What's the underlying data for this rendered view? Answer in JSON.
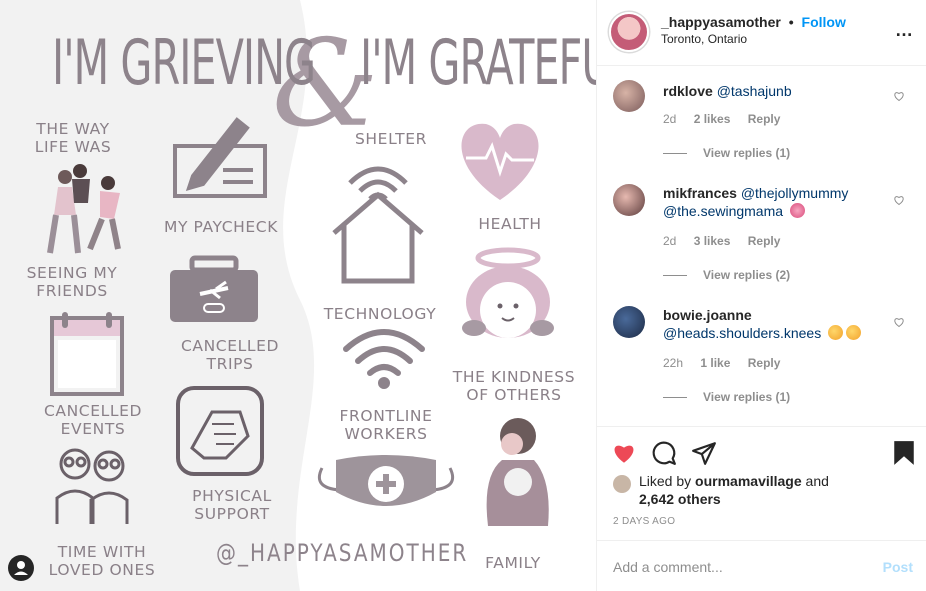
{
  "image": {
    "title_left": "I'M GRIEVING",
    "title_right": "I'M GRATEFUL",
    "ampersand": "&",
    "handle": "@_HAPPYASAMOTHER",
    "grieving_items": [
      "THE WAY\nLIFE WAS",
      "MY PAYCHECK",
      "SEEING MY\nFRIENDS",
      "CANCELLED\nTRIPS",
      "CANCELLED\nEVENTS",
      "PHYSICAL\nSUPPORT",
      "TIME WITH\nLOVED ONES"
    ],
    "grateful_items": [
      "SHELTER",
      "HEALTH",
      "TECHNOLOGY",
      "THE KINDNESS\nOF OTHERS",
      "FRONTLINE\nWORKERS",
      "FAMILY"
    ],
    "colors": {
      "background": "#f2f2f2",
      "wave": "#ffffff",
      "mauve": "#8d838b",
      "pink": "#d9b9cb"
    }
  },
  "header": {
    "username": "_happyasamother",
    "separator": "•",
    "follow_label": "Follow",
    "location": "Toronto, Ontario",
    "more_icon": "…"
  },
  "comments": [
    {
      "username": "rdklove",
      "text_parts": [
        "@tashajunb"
      ],
      "age": "2d",
      "likes": "2 likes",
      "reply_label": "Reply",
      "view_replies": "View replies (1)"
    },
    {
      "username": "mikfrances",
      "text_parts": [
        "@thejollymummy",
        "@the.sewingmama"
      ],
      "age": "2d",
      "likes": "3 likes",
      "reply_label": "Reply",
      "view_replies": "View replies (2)"
    },
    {
      "username": "bowie.joanne",
      "text_parts": [
        "@heads.shoulders.knees"
      ],
      "age": "22h",
      "likes": "1 like",
      "reply_label": "Reply",
      "view_replies": "View replies (1)"
    }
  ],
  "likes": {
    "prefix": "Liked by",
    "liked_by_user": "ourmamavillage",
    "and": "and",
    "others": "2,642 others"
  },
  "timestamp": "2 DAYS AGO",
  "add_comment": {
    "placeholder": "Add a comment...",
    "post_label": "Post"
  },
  "icons": {
    "like": "heart-icon",
    "comment": "comment-bubble-icon",
    "share": "paper-plane-icon",
    "save": "bookmark-icon",
    "accent_like": "#ed4956",
    "link": "#0095f6"
  }
}
